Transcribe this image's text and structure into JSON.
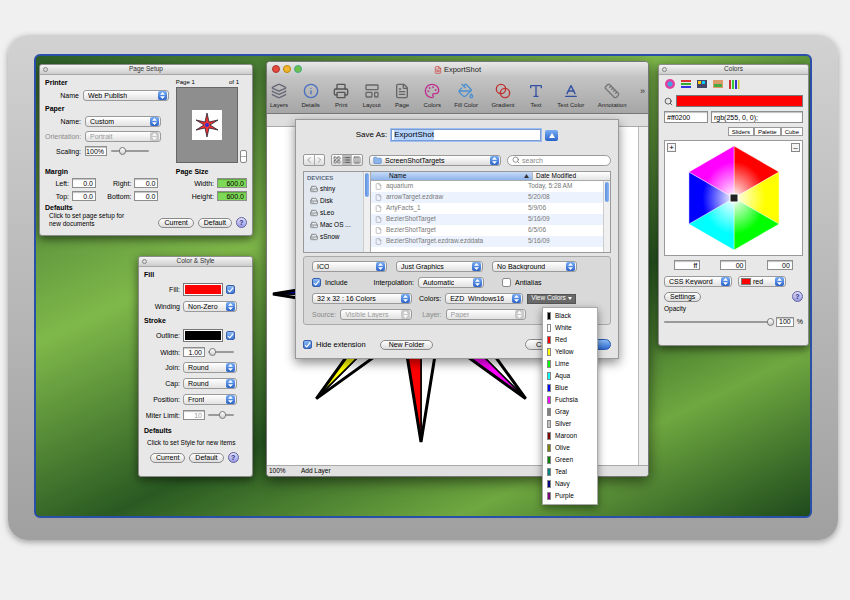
{
  "page_setup": {
    "title": "Page Setup",
    "printer": {
      "heading": "Printer",
      "label": "Name",
      "value": "Web Publish"
    },
    "paper": {
      "heading": "Paper",
      "rows": [
        {
          "label": "Name:",
          "value": "Custom",
          "disabled": false
        },
        {
          "label": "Orientation:",
          "value": "Portrait",
          "disabled": true
        }
      ],
      "scaling": {
        "label": "Scaling:",
        "value": "100%",
        "level": 0.3
      }
    },
    "preview": {
      "page": "Page 1",
      "of": "of 1"
    },
    "margin": {
      "heading": "Margin",
      "fields": [
        {
          "label": "Left:",
          "value": "0.0"
        },
        {
          "label": "Right:",
          "value": "0.0"
        },
        {
          "label": "Top:",
          "value": "0.0"
        },
        {
          "label": "Bottom:",
          "value": "0.0"
        }
      ]
    },
    "page_size": {
      "heading": "Page Size",
      "fields": [
        {
          "label": "Width:",
          "value": "600.0"
        },
        {
          "label": "Height:",
          "value": "600.0"
        }
      ]
    },
    "defaults": {
      "heading": "Defaults",
      "text": "Click to set page setup for new documents",
      "buttons": [
        "Current",
        "Default"
      ],
      "help": "?"
    }
  },
  "color_style": {
    "title": "Color & Style",
    "rows": [
      {
        "kind": "heading",
        "label": "Fill"
      },
      {
        "kind": "swatch",
        "label": "Fill:",
        "color": "#ff0000",
        "checked": true
      },
      {
        "kind": "popup",
        "label": "Winding",
        "value": "Non-Zero"
      },
      {
        "kind": "heading",
        "label": "Stroke"
      },
      {
        "kind": "swatch",
        "label": "Outline:",
        "color": "#000000",
        "checked": true
      },
      {
        "kind": "slider",
        "label": "Width:",
        "value": "1.00",
        "level": 0.15,
        "disabled": false
      },
      {
        "kind": "popup",
        "label": "Join:",
        "value": "Round"
      },
      {
        "kind": "popup",
        "label": "Cap:",
        "value": "Round"
      },
      {
        "kind": "popup",
        "label": "Position:",
        "value": "Front"
      },
      {
        "kind": "slider",
        "label": "Miter Limit:",
        "value": "10",
        "level": 0.55,
        "disabled": true
      }
    ],
    "defaults": {
      "heading": "Defaults",
      "text": "Click to set Style for new items",
      "buttons": [
        "Current",
        "Default"
      ],
      "help": "?"
    }
  },
  "export_window": {
    "title": "ExportShot",
    "toolbar": [
      "Layers",
      "Details",
      "Print",
      "Layout",
      "Page",
      "Colors",
      "Fill Color",
      "Gradient",
      "Text",
      "Text Color",
      "Annotation"
    ],
    "overflow": "»",
    "zoom": "100%",
    "layer": "Add Layer"
  },
  "save_sheet": {
    "save_as_label": "Save As:",
    "file_name": "ExportShot",
    "location": "ScreenShotTargets",
    "search_placeholder": "search",
    "sidebar": {
      "heading": "DEVICES",
      "items": [
        "shiny",
        "Disk",
        "sLeo",
        "Mac OS ...",
        "sSnow"
      ]
    },
    "columns": [
      {
        "label": "Name",
        "selected": true
      },
      {
        "label": "Date Modified",
        "selected": false
      }
    ],
    "rows": [
      {
        "name": "aquarium",
        "date": "Today, 5:28 AM"
      },
      {
        "name": "arrowTarget.ezdraw",
        "date": "5/20/08"
      },
      {
        "name": "ArtyFacts_1",
        "date": "5/9/06"
      },
      {
        "name": "BezierShotTarget",
        "date": "5/16/09"
      },
      {
        "name": "BezierShotTarget",
        "date": "6/5/06"
      },
      {
        "name": "BezierShotTarget.ezdraw.ezddata",
        "date": "5/16/09"
      }
    ],
    "options": {
      "format": "ICO",
      "content": "Just Graphics",
      "background": "No Background",
      "include": {
        "label": "Include",
        "checked": true
      },
      "interpolation": {
        "label": "Interpolation:",
        "value": "Automatic"
      },
      "antialias": {
        "label": "Antialias",
        "checked": false
      },
      "size": "32 x 32 : 16 Colors",
      "colors": {
        "label": "Colors:",
        "value": "EZD_Windows16"
      },
      "view_colors": {
        "label": "View Colors",
        "pressed": true
      },
      "source": {
        "label": "Source:",
        "value": "Visible Layers",
        "disabled": true
      },
      "layer": {
        "label": "Layer:",
        "value": "Paper",
        "disabled": true
      }
    },
    "hide_extension": {
      "label": "Hide extension",
      "checked": true
    },
    "new_folder": "New Folder",
    "cancel": "Cance"
  },
  "colors_menu": {
    "items": [
      {
        "label": "Black",
        "color": "#000000"
      },
      {
        "label": "White",
        "color": "#ffffff"
      },
      {
        "label": "Red",
        "color": "#ff0000"
      },
      {
        "label": "Yellow",
        "color": "#ffff00"
      },
      {
        "label": "Lime",
        "color": "#00ff00"
      },
      {
        "label": "Aqua",
        "color": "#00ffff"
      },
      {
        "label": "Blue",
        "color": "#0000ff"
      },
      {
        "label": "Fuchsia",
        "color": "#ff00ff"
      },
      {
        "label": "Gray",
        "color": "#808080"
      },
      {
        "label": "Silver",
        "color": "#c0c0c0"
      },
      {
        "label": "Maroon",
        "color": "#800000"
      },
      {
        "label": "Olive",
        "color": "#808000"
      },
      {
        "label": "Green",
        "color": "#008000"
      },
      {
        "label": "Teal",
        "color": "#008080"
      },
      {
        "label": "Navy",
        "color": "#000080"
      },
      {
        "label": "Purple",
        "color": "#800080"
      }
    ]
  },
  "colors_panel": {
    "title": "Colors",
    "current_color": "#ff0000",
    "hex": "#ff0200",
    "rgb": "rgb(255, 0, 0);",
    "tabs": [
      {
        "label": "Sliders",
        "selected": false
      },
      {
        "label": "Palette",
        "selected": false
      },
      {
        "label": "Cube",
        "selected": false
      }
    ],
    "zoom_in": "+",
    "zoom_out": "–",
    "components": [
      "ff",
      "00",
      "00"
    ],
    "keyword_mode": "CSS Keyword",
    "keyword": {
      "value": "red",
      "color": "#ff0000"
    },
    "settings": "Settings",
    "help": "?",
    "opacity": {
      "label": "Opacity",
      "level": 1,
      "value": "100",
      "unit": "%"
    }
  }
}
